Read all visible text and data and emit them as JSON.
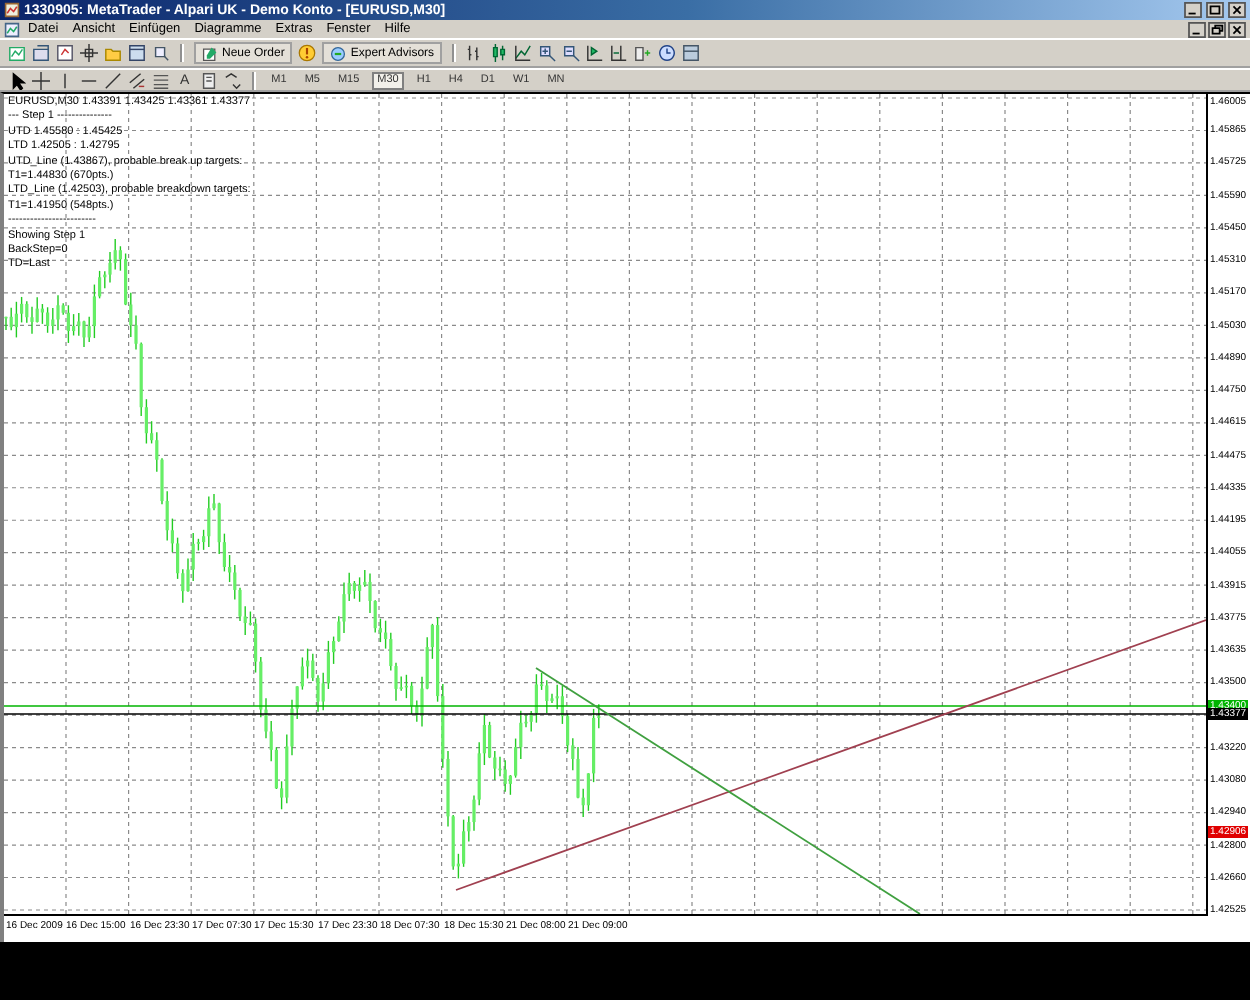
{
  "window": {
    "title": "1330905: MetaTrader - Alpari UK - Demo Konto - [EURUSD,M30]"
  },
  "menu": [
    "Datei",
    "Ansicht",
    "Einfügen",
    "Diagramme",
    "Extras",
    "Fenster",
    "Hilfe"
  ],
  "toolbar": {
    "new_order": "Neue Order",
    "expert_advisors": "Expert Advisors",
    "text_tool": "A"
  },
  "timeframes": [
    {
      "label": "M1",
      "selected": false
    },
    {
      "label": "M5",
      "selected": false
    },
    {
      "label": "M15",
      "selected": false
    },
    {
      "label": "M30",
      "selected": true
    },
    {
      "label": "H1",
      "selected": false
    },
    {
      "label": "H4",
      "selected": false
    },
    {
      "label": "D1",
      "selected": false
    },
    {
      "label": "W1",
      "selected": false
    },
    {
      "label": "MN",
      "selected": false
    }
  ],
  "chart": {
    "header": "EURUSD,M30  1.43391 1.43425 1.43361 1.43377",
    "info_lines": [
      "--- Step 1 ---------------",
      "UTD 1.45580 : 1.45425",
      "LTD 1.42505 : 1.42795",
      "UTD_Line (1.43867), probable break up targets:",
      "T1=1.44830 (670pts.)",
      "LTD_Line (1.42503), probable breakdown targets:",
      "T1=1.41950 (548pts.)",
      "------------------------",
      "Showing Step 1",
      "BackStep=0",
      "TD=Last"
    ],
    "price_labels": [
      "1.46005",
      "1.45865",
      "1.45725",
      "1.45590",
      "1.45450",
      "1.45310",
      "1.45170",
      "1.45030",
      "1.44890",
      "1.44750",
      "1.44615",
      "1.44475",
      "1.44335",
      "1.44195",
      "1.44055",
      "1.43915",
      "1.43775",
      "1.43635",
      "1.43500",
      "1.43220",
      "1.43080",
      "1.42940",
      "1.42800",
      "1.42660",
      "1.42525"
    ],
    "markers": [
      {
        "text": "1.43400",
        "color": "#00b400"
      },
      {
        "text": "1.43377",
        "color": "#000000"
      },
      {
        "text": "1.42906",
        "color": "#e00000"
      }
    ],
    "time_labels": [
      "16 Dec 2009",
      "16 Dec 15:00",
      "16 Dec 23:30",
      "17 Dec 07:30",
      "17 Dec 15:30",
      "17 Dec 23:30",
      "18 Dec 07:30",
      "18 Dec 15:30",
      "21 Dec 08:00",
      "21 Dec 09:00"
    ]
  }
}
